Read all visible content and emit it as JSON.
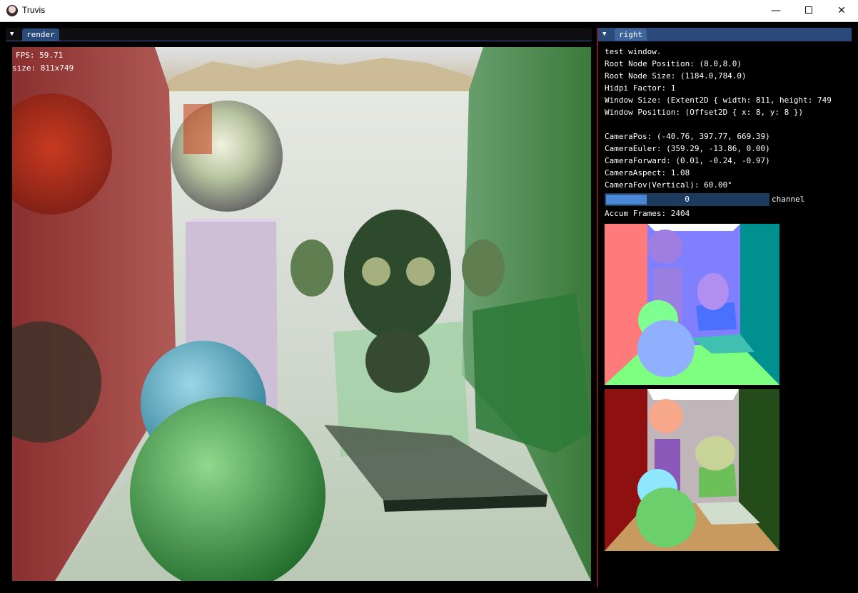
{
  "window": {
    "title": "Truvis",
    "minimize_glyph": "—",
    "close_glyph": "✕"
  },
  "render_panel": {
    "tab_label": "render",
    "fps_text": "FPS: 59.71",
    "size_text": "size: 811x749"
  },
  "right_panel": {
    "tab_label": "right",
    "lines": {
      "title": "test window.",
      "root_pos": "Root Node Position: (8.0,8.0)",
      "root_size": "Root Node Size: (1184.0,784.0)",
      "hidpi": "Hidpi Factor: 1",
      "win_size": "Window Size: (Extent2D { width: 811, height: 749",
      "win_pos": "Window Position: (Offset2D { x: 8, y: 8 })",
      "cam_pos": "CameraPos: (-40.76, 397.77, 669.39)",
      "cam_euler": "CameraEuler: (359.29, -13.86, 0.00)",
      "cam_forward": "CameraForward: (0.01, -0.24, -0.97)",
      "cam_aspect": "CameraAspect: 1.08",
      "cam_fov": "CameraFov(Vertical): 60.00°"
    },
    "channel_slider": {
      "value": "0",
      "label": "channel",
      "fill_fraction": 0.25
    },
    "accum_frames": "Accum Frames: 2404"
  },
  "icons": {
    "tab_collapse": "triangle-down-icon",
    "app": "app-icon"
  }
}
